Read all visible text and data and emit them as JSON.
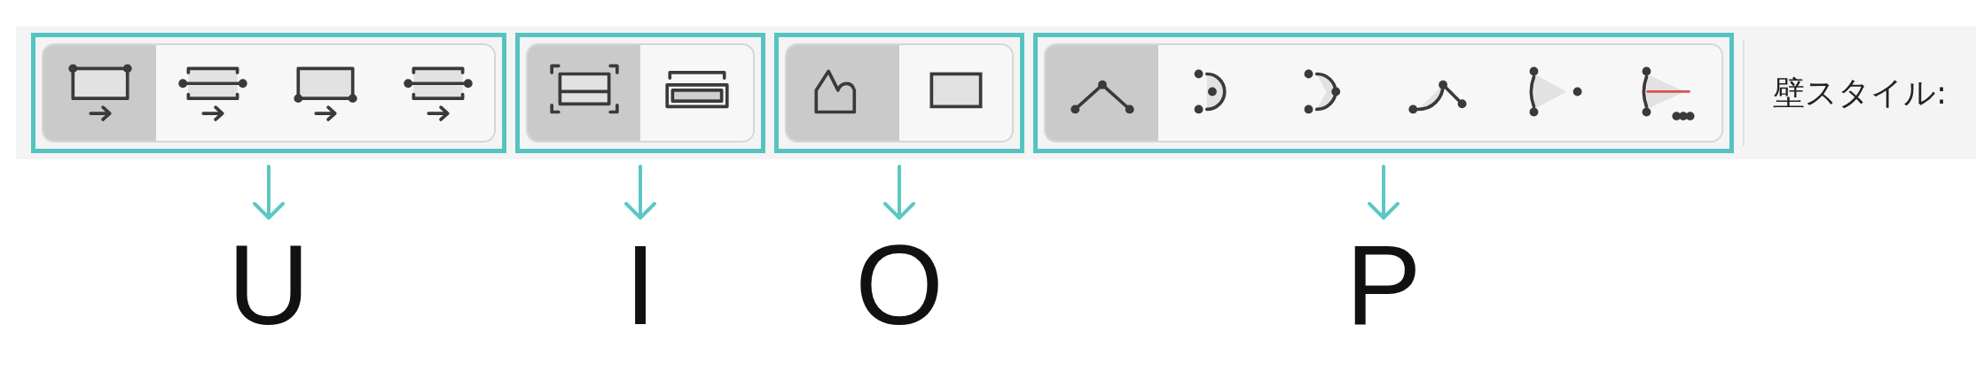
{
  "groups": [
    {
      "label": "U",
      "buttons": [
        {
          "kind": "top-edge",
          "selected": true
        },
        {
          "kind": "center-line-a",
          "selected": false
        },
        {
          "kind": "bottom-edge",
          "selected": false
        },
        {
          "kind": "center-line-b",
          "selected": false
        }
      ]
    },
    {
      "label": "I",
      "buttons": [
        {
          "kind": "frame-outer",
          "selected": true
        },
        {
          "kind": "frame-inner",
          "selected": false
        }
      ]
    },
    {
      "label": "O",
      "buttons": [
        {
          "kind": "polygon",
          "selected": true
        },
        {
          "kind": "rectangle",
          "selected": false
        }
      ]
    },
    {
      "label": "P",
      "buttons": [
        {
          "kind": "polyline",
          "selected": true
        },
        {
          "kind": "arc-center",
          "selected": false
        },
        {
          "kind": "arc-3pt",
          "selected": false
        },
        {
          "kind": "arc-tangent",
          "selected": false
        },
        {
          "kind": "fan-a",
          "selected": false
        },
        {
          "kind": "fan-b",
          "selected": false
        }
      ]
    }
  ],
  "wall_style_label": "壁スタイル:"
}
